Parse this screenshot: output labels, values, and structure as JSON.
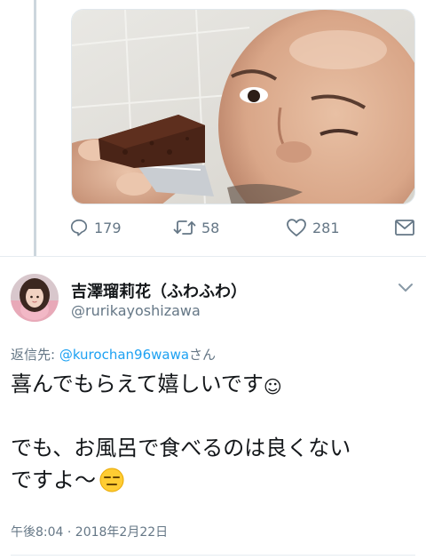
{
  "parent_tweet": {
    "actions": {
      "reply_count": "179",
      "retweet_count": "58",
      "like_count": "281"
    },
    "icons": {
      "reply": "reply-icon",
      "retweet": "retweet-icon",
      "like": "heart-icon",
      "dm": "mail-icon"
    }
  },
  "reply_tweet": {
    "display_name": "吉澤瑠莉花（ふわふわ）",
    "handle": "@rurikayoshizawa",
    "reply_prefix": "返信先: ",
    "reply_mention": "@kurochan96wawa",
    "reply_suffix": "さん",
    "text_line_1": "喜んでもらえて嬉しいです",
    "text_line_2": "でも、お風呂で食べるのは良くない",
    "text_line_3": "ですよ〜",
    "emoji_1": "☺",
    "emoji_2": "expressionless-face-emoji",
    "timestamp": "午後8:04 · 2018年2月22日"
  },
  "colors": {
    "link": "#1da1f2",
    "secondary_text": "#657786",
    "primary_text": "#14171a",
    "divider": "#e6ecf0"
  }
}
